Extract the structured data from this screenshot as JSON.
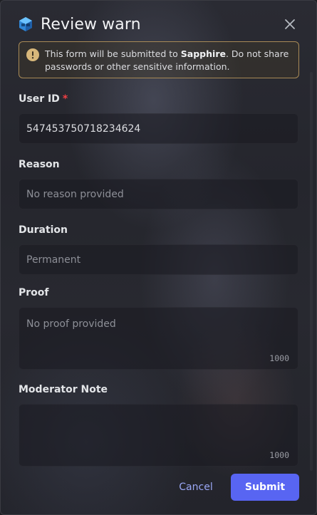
{
  "header": {
    "title": "Review warn",
    "app_icon": "cube-logo-icon",
    "close_icon": "close-icon"
  },
  "warning": {
    "icon": "exclamation-circle-icon",
    "prefix": "This form will be submitted to ",
    "app_name": "Sapphire",
    "suffix": ". Do not share passwords or other sensitive information."
  },
  "form": {
    "user_id": {
      "label": "User ID",
      "required_mark": "*",
      "value": "547453750718234624"
    },
    "reason": {
      "label": "Reason",
      "placeholder": "No reason provided"
    },
    "duration": {
      "label": "Duration",
      "placeholder": "Permanent"
    },
    "proof": {
      "label": "Proof",
      "placeholder": "No proof provided",
      "char_limit": "1000"
    },
    "moderator_note": {
      "label": "Moderator Note",
      "placeholder": "",
      "char_limit": "1000"
    }
  },
  "footer": {
    "cancel_label": "Cancel",
    "submit_label": "Submit"
  },
  "colors": {
    "accent": "#5865f2",
    "link": "#9aa7f5",
    "warning_border": "#a88a56",
    "required": "#f23f43"
  }
}
